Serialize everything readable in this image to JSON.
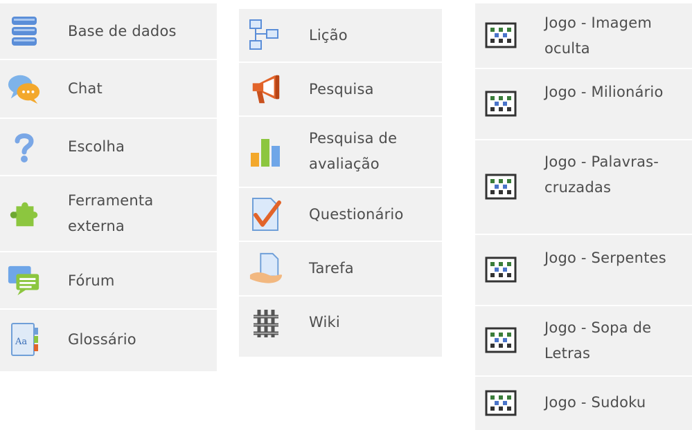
{
  "column_1": {
    "items": [
      {
        "label": "Base de dados",
        "icon": "database-icon"
      },
      {
        "label": "Chat",
        "icon": "chat-bubbles-icon"
      },
      {
        "label": "Escolha",
        "icon": "question-mark-icon"
      },
      {
        "label": "Ferramenta externa",
        "icon": "puzzle-piece-icon"
      },
      {
        "label": "Fórum",
        "icon": "forum-icon"
      },
      {
        "label": "Glossário",
        "icon": "glossary-book-icon"
      }
    ]
  },
  "column_2": {
    "items": [
      {
        "label": "Lição",
        "icon": "lesson-flowchart-icon"
      },
      {
        "label": "Pesquisa",
        "icon": "megaphone-icon"
      },
      {
        "label": "Pesquisa de avaliação",
        "icon": "bar-chart-icon"
      },
      {
        "label": "Questionário",
        "icon": "quiz-checkmark-icon"
      },
      {
        "label": "Tarefa",
        "icon": "assignment-hand-icon"
      },
      {
        "label": "Wiki",
        "icon": "wiki-icon"
      }
    ]
  },
  "column_3": {
    "items": [
      {
        "label": "Jogo - Imagem oculta",
        "icon": "game-board-icon"
      },
      {
        "label": "Jogo - Milionário",
        "icon": "game-board-icon"
      },
      {
        "label": "Jogo - Palavras-cruzadas",
        "icon": "game-board-icon"
      },
      {
        "label": "Jogo - Serpentes",
        "icon": "game-board-icon"
      },
      {
        "label": "Jogo - Sopa de Letras",
        "icon": "game-board-icon"
      },
      {
        "label": "Jogo - Sudoku",
        "icon": "game-board-icon"
      }
    ]
  }
}
